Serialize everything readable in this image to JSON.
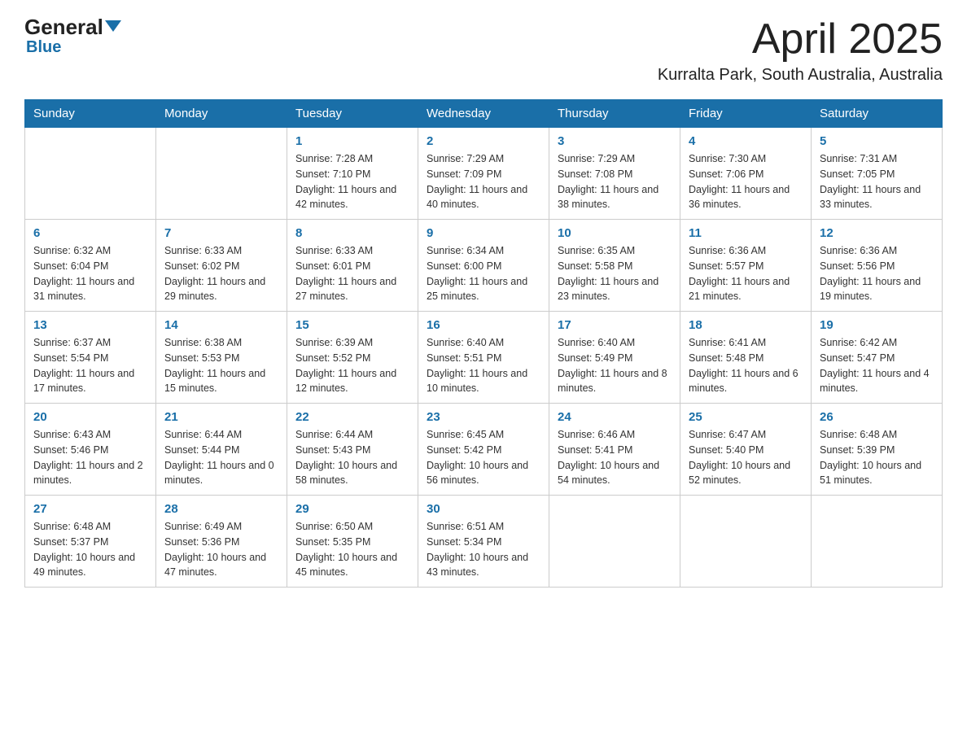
{
  "logo": {
    "part1": "General",
    "triangle": "▼",
    "part2": "Blue"
  },
  "title": {
    "month_year": "April 2025",
    "location": "Kurralta Park, South Australia, Australia"
  },
  "days_of_week": [
    "Sunday",
    "Monday",
    "Tuesday",
    "Wednesday",
    "Thursday",
    "Friday",
    "Saturday"
  ],
  "weeks": [
    [
      {
        "day": "",
        "sunrise": "",
        "sunset": "",
        "daylight": ""
      },
      {
        "day": "",
        "sunrise": "",
        "sunset": "",
        "daylight": ""
      },
      {
        "day": "1",
        "sunrise": "Sunrise: 7:28 AM",
        "sunset": "Sunset: 7:10 PM",
        "daylight": "Daylight: 11 hours and 42 minutes."
      },
      {
        "day": "2",
        "sunrise": "Sunrise: 7:29 AM",
        "sunset": "Sunset: 7:09 PM",
        "daylight": "Daylight: 11 hours and 40 minutes."
      },
      {
        "day": "3",
        "sunrise": "Sunrise: 7:29 AM",
        "sunset": "Sunset: 7:08 PM",
        "daylight": "Daylight: 11 hours and 38 minutes."
      },
      {
        "day": "4",
        "sunrise": "Sunrise: 7:30 AM",
        "sunset": "Sunset: 7:06 PM",
        "daylight": "Daylight: 11 hours and 36 minutes."
      },
      {
        "day": "5",
        "sunrise": "Sunrise: 7:31 AM",
        "sunset": "Sunset: 7:05 PM",
        "daylight": "Daylight: 11 hours and 33 minutes."
      }
    ],
    [
      {
        "day": "6",
        "sunrise": "Sunrise: 6:32 AM",
        "sunset": "Sunset: 6:04 PM",
        "daylight": "Daylight: 11 hours and 31 minutes."
      },
      {
        "day": "7",
        "sunrise": "Sunrise: 6:33 AM",
        "sunset": "Sunset: 6:02 PM",
        "daylight": "Daylight: 11 hours and 29 minutes."
      },
      {
        "day": "8",
        "sunrise": "Sunrise: 6:33 AM",
        "sunset": "Sunset: 6:01 PM",
        "daylight": "Daylight: 11 hours and 27 minutes."
      },
      {
        "day": "9",
        "sunrise": "Sunrise: 6:34 AM",
        "sunset": "Sunset: 6:00 PM",
        "daylight": "Daylight: 11 hours and 25 minutes."
      },
      {
        "day": "10",
        "sunrise": "Sunrise: 6:35 AM",
        "sunset": "Sunset: 5:58 PM",
        "daylight": "Daylight: 11 hours and 23 minutes."
      },
      {
        "day": "11",
        "sunrise": "Sunrise: 6:36 AM",
        "sunset": "Sunset: 5:57 PM",
        "daylight": "Daylight: 11 hours and 21 minutes."
      },
      {
        "day": "12",
        "sunrise": "Sunrise: 6:36 AM",
        "sunset": "Sunset: 5:56 PM",
        "daylight": "Daylight: 11 hours and 19 minutes."
      }
    ],
    [
      {
        "day": "13",
        "sunrise": "Sunrise: 6:37 AM",
        "sunset": "Sunset: 5:54 PM",
        "daylight": "Daylight: 11 hours and 17 minutes."
      },
      {
        "day": "14",
        "sunrise": "Sunrise: 6:38 AM",
        "sunset": "Sunset: 5:53 PM",
        "daylight": "Daylight: 11 hours and 15 minutes."
      },
      {
        "day": "15",
        "sunrise": "Sunrise: 6:39 AM",
        "sunset": "Sunset: 5:52 PM",
        "daylight": "Daylight: 11 hours and 12 minutes."
      },
      {
        "day": "16",
        "sunrise": "Sunrise: 6:40 AM",
        "sunset": "Sunset: 5:51 PM",
        "daylight": "Daylight: 11 hours and 10 minutes."
      },
      {
        "day": "17",
        "sunrise": "Sunrise: 6:40 AM",
        "sunset": "Sunset: 5:49 PM",
        "daylight": "Daylight: 11 hours and 8 minutes."
      },
      {
        "day": "18",
        "sunrise": "Sunrise: 6:41 AM",
        "sunset": "Sunset: 5:48 PM",
        "daylight": "Daylight: 11 hours and 6 minutes."
      },
      {
        "day": "19",
        "sunrise": "Sunrise: 6:42 AM",
        "sunset": "Sunset: 5:47 PM",
        "daylight": "Daylight: 11 hours and 4 minutes."
      }
    ],
    [
      {
        "day": "20",
        "sunrise": "Sunrise: 6:43 AM",
        "sunset": "Sunset: 5:46 PM",
        "daylight": "Daylight: 11 hours and 2 minutes."
      },
      {
        "day": "21",
        "sunrise": "Sunrise: 6:44 AM",
        "sunset": "Sunset: 5:44 PM",
        "daylight": "Daylight: 11 hours and 0 minutes."
      },
      {
        "day": "22",
        "sunrise": "Sunrise: 6:44 AM",
        "sunset": "Sunset: 5:43 PM",
        "daylight": "Daylight: 10 hours and 58 minutes."
      },
      {
        "day": "23",
        "sunrise": "Sunrise: 6:45 AM",
        "sunset": "Sunset: 5:42 PM",
        "daylight": "Daylight: 10 hours and 56 minutes."
      },
      {
        "day": "24",
        "sunrise": "Sunrise: 6:46 AM",
        "sunset": "Sunset: 5:41 PM",
        "daylight": "Daylight: 10 hours and 54 minutes."
      },
      {
        "day": "25",
        "sunrise": "Sunrise: 6:47 AM",
        "sunset": "Sunset: 5:40 PM",
        "daylight": "Daylight: 10 hours and 52 minutes."
      },
      {
        "day": "26",
        "sunrise": "Sunrise: 6:48 AM",
        "sunset": "Sunset: 5:39 PM",
        "daylight": "Daylight: 10 hours and 51 minutes."
      }
    ],
    [
      {
        "day": "27",
        "sunrise": "Sunrise: 6:48 AM",
        "sunset": "Sunset: 5:37 PM",
        "daylight": "Daylight: 10 hours and 49 minutes."
      },
      {
        "day": "28",
        "sunrise": "Sunrise: 6:49 AM",
        "sunset": "Sunset: 5:36 PM",
        "daylight": "Daylight: 10 hours and 47 minutes."
      },
      {
        "day": "29",
        "sunrise": "Sunrise: 6:50 AM",
        "sunset": "Sunset: 5:35 PM",
        "daylight": "Daylight: 10 hours and 45 minutes."
      },
      {
        "day": "30",
        "sunrise": "Sunrise: 6:51 AM",
        "sunset": "Sunset: 5:34 PM",
        "daylight": "Daylight: 10 hours and 43 minutes."
      },
      {
        "day": "",
        "sunrise": "",
        "sunset": "",
        "daylight": ""
      },
      {
        "day": "",
        "sunrise": "",
        "sunset": "",
        "daylight": ""
      },
      {
        "day": "",
        "sunrise": "",
        "sunset": "",
        "daylight": ""
      }
    ]
  ]
}
